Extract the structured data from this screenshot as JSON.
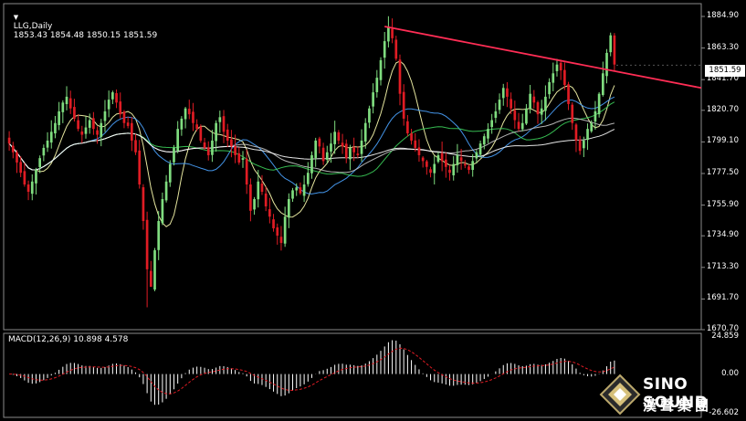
{
  "header": {
    "symbol_timeframe": "LLG,Daily",
    "ohlc": "1853.43 1854.48 1850.15 1851.59",
    "indicator": "MACD(12,26,9) 10.898 4.578"
  },
  "current_price_label": "1851.59",
  "price_axis_labels": [
    "1884.90",
    "1863.30",
    "1841.70",
    "1820.70",
    "1799.10",
    "1777.50",
    "1755.90",
    "1734.90",
    "1713.30",
    "1691.70",
    "1670.70"
  ],
  "macd_axis_labels": [
    "24.859",
    "0.00",
    "-26.602"
  ],
  "watermark": {
    "line1": "SINO SOUND",
    "line2": "漢聲集團"
  },
  "colors": {
    "bull": "#7fdc7f",
    "bear": "#e01c24",
    "trendline": "#ff2d55",
    "macd_signal": "#e01c24",
    "macd_hist": "#ffffff"
  },
  "chart_data": {
    "type": "candlestick",
    "symbol": "LLG",
    "timeframe": "Daily",
    "ylim": [
      1670.7,
      1884.9
    ],
    "macd_ylim": [
      -26.602,
      24.859
    ],
    "last": {
      "open": 1853.43,
      "high": 1854.48,
      "low": 1850.15,
      "close": 1851.59
    },
    "closes": [
      1798,
      1792,
      1785,
      1778,
      1770,
      1765,
      1772,
      1780,
      1788,
      1795,
      1800,
      1806,
      1812,
      1820,
      1826,
      1830,
      1822,
      1815,
      1808,
      1804,
      1809,
      1814,
      1808,
      1804,
      1812,
      1820,
      1828,
      1833,
      1826,
      1818,
      1812,
      1810,
      1800,
      1792,
      1770,
      1745,
      1712,
      1700,
      1725,
      1745,
      1760,
      1772,
      1784,
      1795,
      1808,
      1815,
      1822,
      1818,
      1812,
      1808,
      1800,
      1795,
      1790,
      1800,
      1812,
      1816,
      1806,
      1800,
      1796,
      1790,
      1785,
      1788,
      1770,
      1752,
      1760,
      1772,
      1765,
      1755,
      1748,
      1740,
      1735,
      1730,
      1748,
      1760,
      1766,
      1768,
      1764,
      1770,
      1778,
      1790,
      1800,
      1796,
      1786,
      1792,
      1798,
      1806,
      1800,
      1796,
      1788,
      1795,
      1792,
      1790,
      1800,
      1812,
      1822,
      1833,
      1843,
      1855,
      1868,
      1878,
      1870,
      1856,
      1832,
      1815,
      1805,
      1800,
      1795,
      1790,
      1786,
      1782,
      1778,
      1784,
      1790,
      1786,
      1782,
      1778,
      1784,
      1790,
      1786,
      1783,
      1780,
      1786,
      1792,
      1798,
      1803,
      1808,
      1814,
      1820,
      1828,
      1836,
      1830,
      1822,
      1814,
      1808,
      1812,
      1822,
      1832,
      1826,
      1818,
      1822,
      1830,
      1840,
      1846,
      1852,
      1848,
      1838,
      1825,
      1812,
      1800,
      1793,
      1800,
      1808,
      1812,
      1820,
      1832,
      1846,
      1860,
      1872,
      1852
    ],
    "moving_averages": [
      {
        "color": "#ffffb0"
      },
      {
        "color": "#4aa3ff"
      },
      {
        "color": "#3ccf5a"
      },
      {
        "color": "#c8c8c8"
      },
      {
        "color": "#ffffff"
      }
    ]
  }
}
